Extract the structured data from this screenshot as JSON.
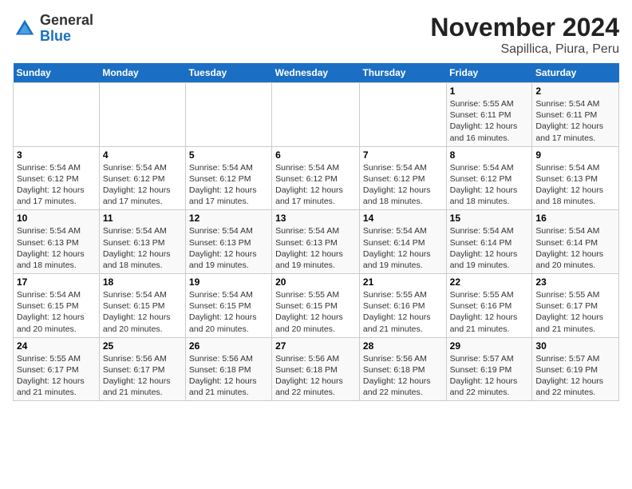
{
  "logo": {
    "general": "General",
    "blue": "Blue"
  },
  "header": {
    "month_title": "November 2024",
    "location": "Sapillica, Piura, Peru"
  },
  "weekdays": [
    "Sunday",
    "Monday",
    "Tuesday",
    "Wednesday",
    "Thursday",
    "Friday",
    "Saturday"
  ],
  "weeks": [
    [
      {
        "day": "",
        "info": ""
      },
      {
        "day": "",
        "info": ""
      },
      {
        "day": "",
        "info": ""
      },
      {
        "day": "",
        "info": ""
      },
      {
        "day": "",
        "info": ""
      },
      {
        "day": "1",
        "info": "Sunrise: 5:55 AM\nSunset: 6:11 PM\nDaylight: 12 hours and 16 minutes."
      },
      {
        "day": "2",
        "info": "Sunrise: 5:54 AM\nSunset: 6:11 PM\nDaylight: 12 hours and 17 minutes."
      }
    ],
    [
      {
        "day": "3",
        "info": "Sunrise: 5:54 AM\nSunset: 6:12 PM\nDaylight: 12 hours and 17 minutes."
      },
      {
        "day": "4",
        "info": "Sunrise: 5:54 AM\nSunset: 6:12 PM\nDaylight: 12 hours and 17 minutes."
      },
      {
        "day": "5",
        "info": "Sunrise: 5:54 AM\nSunset: 6:12 PM\nDaylight: 12 hours and 17 minutes."
      },
      {
        "day": "6",
        "info": "Sunrise: 5:54 AM\nSunset: 6:12 PM\nDaylight: 12 hours and 17 minutes."
      },
      {
        "day": "7",
        "info": "Sunrise: 5:54 AM\nSunset: 6:12 PM\nDaylight: 12 hours and 18 minutes."
      },
      {
        "day": "8",
        "info": "Sunrise: 5:54 AM\nSunset: 6:12 PM\nDaylight: 12 hours and 18 minutes."
      },
      {
        "day": "9",
        "info": "Sunrise: 5:54 AM\nSunset: 6:13 PM\nDaylight: 12 hours and 18 minutes."
      }
    ],
    [
      {
        "day": "10",
        "info": "Sunrise: 5:54 AM\nSunset: 6:13 PM\nDaylight: 12 hours and 18 minutes."
      },
      {
        "day": "11",
        "info": "Sunrise: 5:54 AM\nSunset: 6:13 PM\nDaylight: 12 hours and 18 minutes."
      },
      {
        "day": "12",
        "info": "Sunrise: 5:54 AM\nSunset: 6:13 PM\nDaylight: 12 hours and 19 minutes."
      },
      {
        "day": "13",
        "info": "Sunrise: 5:54 AM\nSunset: 6:13 PM\nDaylight: 12 hours and 19 minutes."
      },
      {
        "day": "14",
        "info": "Sunrise: 5:54 AM\nSunset: 6:14 PM\nDaylight: 12 hours and 19 minutes."
      },
      {
        "day": "15",
        "info": "Sunrise: 5:54 AM\nSunset: 6:14 PM\nDaylight: 12 hours and 19 minutes."
      },
      {
        "day": "16",
        "info": "Sunrise: 5:54 AM\nSunset: 6:14 PM\nDaylight: 12 hours and 20 minutes."
      }
    ],
    [
      {
        "day": "17",
        "info": "Sunrise: 5:54 AM\nSunset: 6:15 PM\nDaylight: 12 hours and 20 minutes."
      },
      {
        "day": "18",
        "info": "Sunrise: 5:54 AM\nSunset: 6:15 PM\nDaylight: 12 hours and 20 minutes."
      },
      {
        "day": "19",
        "info": "Sunrise: 5:54 AM\nSunset: 6:15 PM\nDaylight: 12 hours and 20 minutes."
      },
      {
        "day": "20",
        "info": "Sunrise: 5:55 AM\nSunset: 6:15 PM\nDaylight: 12 hours and 20 minutes."
      },
      {
        "day": "21",
        "info": "Sunrise: 5:55 AM\nSunset: 6:16 PM\nDaylight: 12 hours and 21 minutes."
      },
      {
        "day": "22",
        "info": "Sunrise: 5:55 AM\nSunset: 6:16 PM\nDaylight: 12 hours and 21 minutes."
      },
      {
        "day": "23",
        "info": "Sunrise: 5:55 AM\nSunset: 6:17 PM\nDaylight: 12 hours and 21 minutes."
      }
    ],
    [
      {
        "day": "24",
        "info": "Sunrise: 5:55 AM\nSunset: 6:17 PM\nDaylight: 12 hours and 21 minutes."
      },
      {
        "day": "25",
        "info": "Sunrise: 5:56 AM\nSunset: 6:17 PM\nDaylight: 12 hours and 21 minutes."
      },
      {
        "day": "26",
        "info": "Sunrise: 5:56 AM\nSunset: 6:18 PM\nDaylight: 12 hours and 21 minutes."
      },
      {
        "day": "27",
        "info": "Sunrise: 5:56 AM\nSunset: 6:18 PM\nDaylight: 12 hours and 22 minutes."
      },
      {
        "day": "28",
        "info": "Sunrise: 5:56 AM\nSunset: 6:18 PM\nDaylight: 12 hours and 22 minutes."
      },
      {
        "day": "29",
        "info": "Sunrise: 5:57 AM\nSunset: 6:19 PM\nDaylight: 12 hours and 22 minutes."
      },
      {
        "day": "30",
        "info": "Sunrise: 5:57 AM\nSunset: 6:19 PM\nDaylight: 12 hours and 22 minutes."
      }
    ]
  ]
}
